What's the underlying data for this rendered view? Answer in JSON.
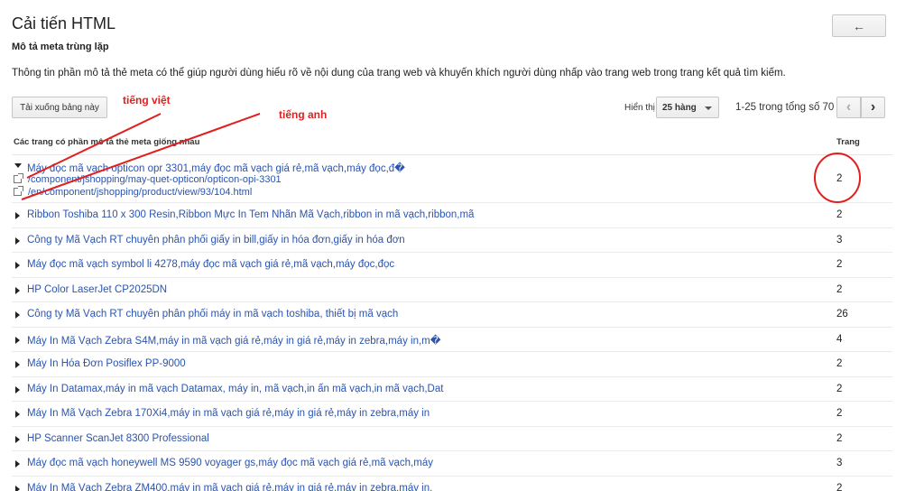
{
  "header": {
    "title": "Cải tiến HTML",
    "back_icon": "←"
  },
  "section": {
    "title": "Mô tả meta trùng lặp",
    "description": "Thông tin phần mô tả thẻ meta có thể giúp người dùng hiểu rõ về nội dung của trang web và khuyến khích người dùng nhấp vào trang web trong trang kết quả tìm kiếm."
  },
  "toolbar": {
    "download_label": "Tải xuống bảng này",
    "show_label": "Hiển thị",
    "rows_value": "25 hàng",
    "range_text": "1-25 trong tổng số 70",
    "prev_icon": "‹",
    "next_icon": "›"
  },
  "table": {
    "header_pages": "Các trang có phần mô tả thẻ meta giống nhau",
    "header_count": "Trang",
    "expanded_row": {
      "title": "Máy đọc mã vạch opticon opr 3301,máy đọc mã vạch giá rẻ,mã vạch,máy đọc,đ�",
      "urls": [
        "/component/jshopping/may-quet-opticon/opticon-opi-3301",
        "/en/component/jshopping/product/view/93/104.html"
      ],
      "count": "2"
    },
    "rows": [
      {
        "title": "Ribbon Toshiba 110 x 300 Resin,Ribbon Mực In Tem Nhãn Mã Vạch,ribbon in mã vạch,ribbon,mã",
        "count": "2"
      },
      {
        "title": "Công ty Mã Vạch RT chuyên phân phối giấy in bill,giấy in hóa đơn,giấy in hóa đơn",
        "count": "3"
      },
      {
        "title": "Máy đọc mã vạch symbol li 4278,máy đọc mã vạch giá rẻ,mã vạch,máy đọc,đọc",
        "count": "2"
      },
      {
        "title": "HP Color LaserJet CP2025DN",
        "count": "2"
      },
      {
        "title": "Công ty Mã Vạch RT chuyên phân phối máy in mã vạch toshiba, thiết bị mã vạch",
        "count": "26"
      },
      {
        "title": "Máy In Mã Vạch Zebra S4M,máy in mã vạch giá rẻ,máy in giá rẻ,máy in zebra,máy in,m�",
        "count": "4"
      },
      {
        "title": "Máy In Hóa Đơn Posiflex PP-9000",
        "count": "2"
      },
      {
        "title": "Máy In Datamax,máy in mã vạch Datamax, máy in, mã vạch,in ấn mã vạch,in mã vạch,Dat",
        "count": "2"
      },
      {
        "title": "Máy In Mã Vạch Zebra 170Xi4,máy in mã vạch giá rẻ,máy in giá rẻ,máy in zebra,máy in",
        "count": "2"
      },
      {
        "title": "HP Scanner ScanJet 8300 Professional",
        "count": "2"
      },
      {
        "title": "Máy đọc mã vạch honeywell MS 9590 voyager gs,máy đọc mã vạch giá rẻ,mã vạch,máy",
        "count": "3"
      },
      {
        "title": "Máy In Mã Vạch Zebra ZM400,máy in mã vạch giá rẻ,máy in giá rẻ,máy in zebra,máy in,",
        "count": "2"
      }
    ]
  },
  "annotations": {
    "vietnamese": "tiếng việt",
    "english": "tiếng anh",
    "color": "#e02020"
  },
  "colors": {
    "link": "#2a54b0",
    "border": "#c6c6c6"
  }
}
